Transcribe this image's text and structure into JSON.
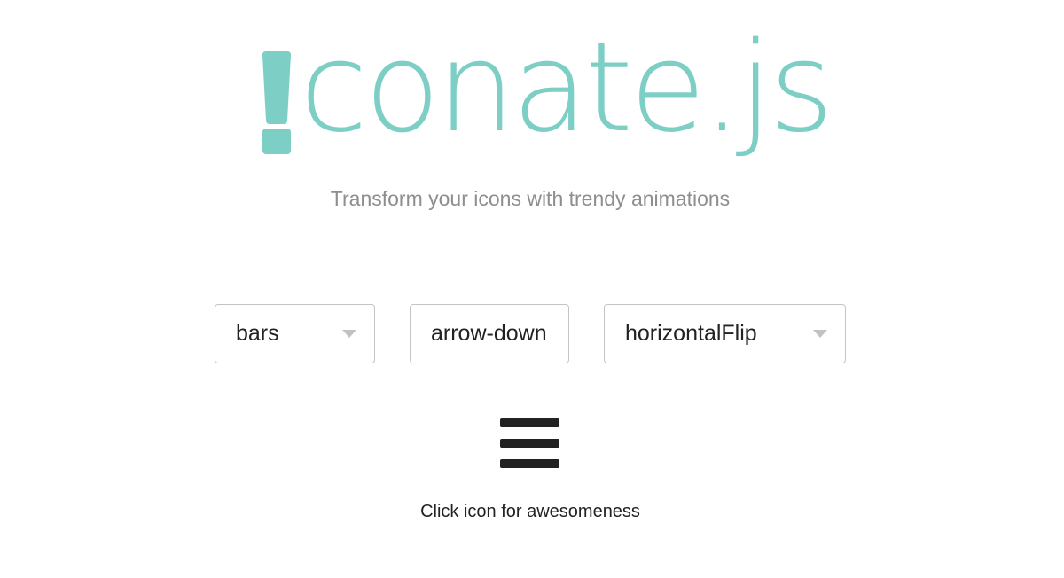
{
  "brand": {
    "logo_word": "conate.js",
    "logo_accent_color": "#7dcfc6",
    "logo_mark_icon": "exclamation-icon"
  },
  "tagline": "Transform your icons with trendy animations",
  "controls": {
    "icon_select": {
      "value": "bars"
    },
    "icon_to_select": {
      "value": "arrow-down"
    },
    "animation_select": {
      "value": "horizontalFlip"
    }
  },
  "preview": {
    "icon": "bars-icon",
    "hint": "Click icon for awesomeness"
  }
}
